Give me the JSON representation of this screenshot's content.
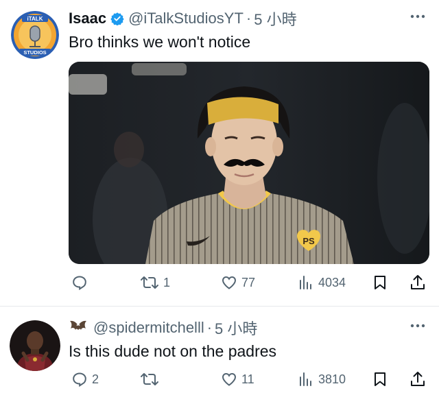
{
  "tweets": [
    {
      "display_name": "Isaac",
      "handle": "@iTalkStudiosYT",
      "separator": "·",
      "time": "5 小時",
      "text": "Bro thinks we won't notice",
      "avatar_text_top": "iTALK",
      "avatar_text_bottom": "STUDIOS",
      "media_badge": "PS",
      "actions": {
        "replies": "",
        "retweets": "1",
        "likes": "77",
        "views": "4034"
      }
    },
    {
      "display_name": "",
      "handle": "@spidermitchelll",
      "separator": "·",
      "time": "5 小時",
      "text": "Is this dude not on the padres",
      "actions": {
        "replies": "2",
        "retweets": "",
        "likes": "11",
        "views": "3810"
      }
    }
  ],
  "colors": {
    "text": "#0f1419",
    "secondary": "#536471",
    "verified": "#1d9bf0",
    "divider": "#e6e9ec"
  }
}
